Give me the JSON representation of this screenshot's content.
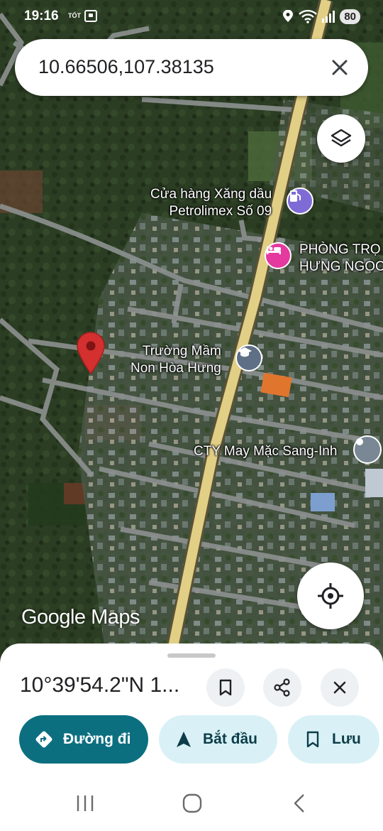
{
  "status_bar": {
    "time": "19:16",
    "carrier": "TỐT",
    "battery": "80"
  },
  "search": {
    "query": "10.66506,107.38135"
  },
  "map": {
    "pois": [
      {
        "id": "gas",
        "label_line1": "Cửa hàng Xăng dầu",
        "label_line2": "Petrolimex Số 09",
        "icon": "gas-station-icon",
        "color": "#7e6bd6"
      },
      {
        "id": "lodging",
        "label_line1": "PHÒNG TRỌ",
        "label_line2": "HƯNG NGỌC",
        "icon": "bed-icon",
        "color": "#e5399f"
      },
      {
        "id": "school",
        "label_line1": "Trường Mầm",
        "label_line2": "Non Hòa Hưng",
        "icon": "school-cap-icon",
        "color": "#5f6f86"
      },
      {
        "id": "company",
        "label_line1": "CTY May Mặc Sang-Inh",
        "icon": "place-pin-icon",
        "color": "#7a8794"
      }
    ],
    "logo_text": "Google Maps",
    "dropped_pin_color": "#d3302f"
  },
  "sheet": {
    "title": "10°39'54.2\"N 1...",
    "directions_label": "Đường đi",
    "start_label": "Bắt đầu",
    "save_label": "Lưu"
  },
  "colors": {
    "primary": "#0b6f80",
    "tonal": "#d9f1f6",
    "road_main": "#e1cf86"
  }
}
